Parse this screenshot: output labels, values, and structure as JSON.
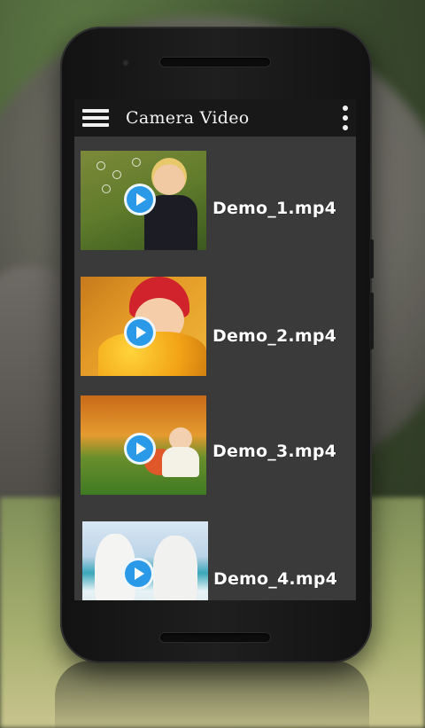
{
  "app": {
    "title": "Camera Video"
  },
  "icons": {
    "menu": "hamburger-menu-icon",
    "more": "more-vertical-icon",
    "play": "play-icon"
  },
  "colors": {
    "appbar": "#181818",
    "list_bg": "#3a3a3a",
    "play_button": "#2a9ae8",
    "text": "#ffffff"
  },
  "videos": [
    {
      "file_name": "Demo_1.mp4"
    },
    {
      "file_name": "Demo_2.mp4"
    },
    {
      "file_name": "Demo_3.mp4"
    },
    {
      "file_name": "Demo_4.mp4"
    }
  ]
}
